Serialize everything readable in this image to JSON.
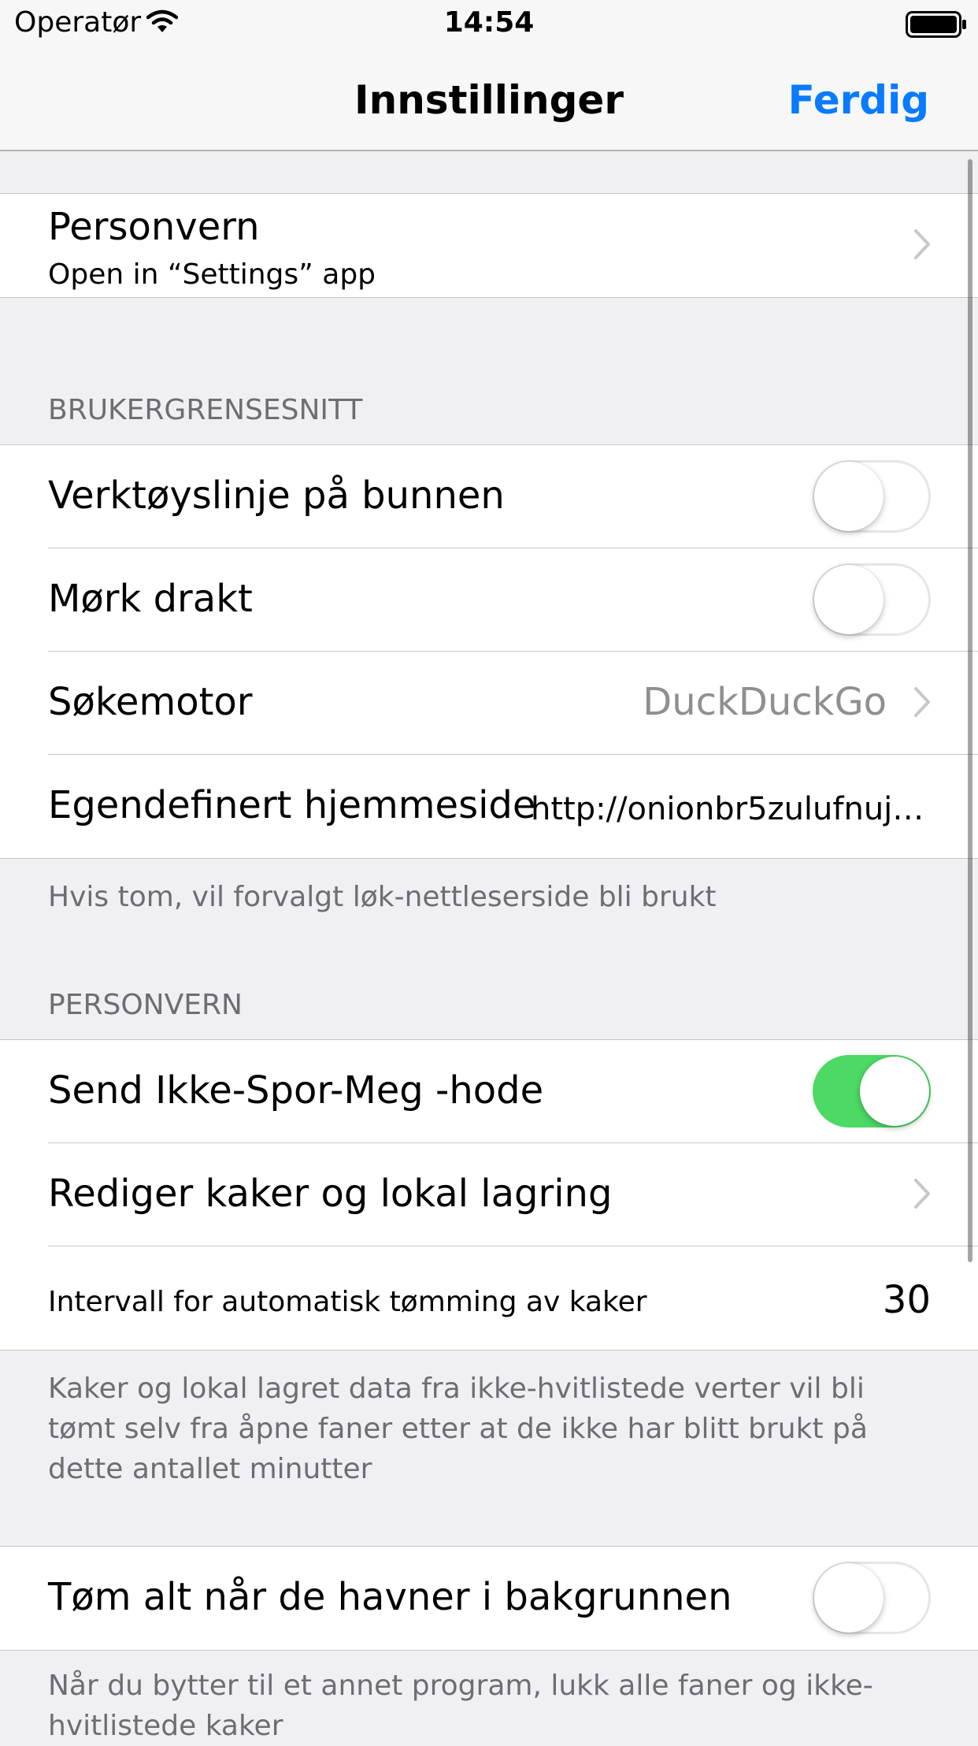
{
  "status_bar": {
    "carrier": "Operatør",
    "time": "14:54"
  },
  "nav_bar": {
    "title": "Innstillinger",
    "done_label": "Ferdig"
  },
  "privacy_link": {
    "title": "Personvern",
    "subtitle": "Open in “Settings” app"
  },
  "ui_section": {
    "header": "BRUKERGRENSESNITT",
    "bottom_toolbar": {
      "label": "Verktøyslinje på bunnen",
      "enabled": false
    },
    "dark_theme": {
      "label": "Mørk drakt",
      "enabled": false
    },
    "search_engine": {
      "label": "Søkemotor",
      "value": "DuckDuckGo"
    },
    "homepage": {
      "label": "Egendefinert hjemmeside",
      "value": "http://onionbr5zulufnuj.o…"
    },
    "footer": "Hvis tom, vil forvalgt løk-nettleserside bli brukt"
  },
  "privacy_section": {
    "header": "PERSONVERN",
    "dnt": {
      "label": "Send Ikke-Spor-Meg -hode",
      "enabled": true
    },
    "cookies": {
      "label": "Rediger kaker og lokal lagring"
    },
    "interval": {
      "label": "Intervall for automatisk tømming av kaker",
      "value": "30"
    },
    "footer": "Kaker og lokal lagret data fra ikke-hvitlistede verter vil bli tømt selv fra åpne faner etter at de ikke har blitt brukt på dette antallet minutter"
  },
  "background_section": {
    "clear_all": {
      "label": "Tøm alt når de havner i bakgrunnen",
      "enabled": false
    },
    "footer": "Når du bytter til et annet program, lukk alle faner og ikke-hvitlistede kaker"
  },
  "colors": {
    "accent": "#0a7aff",
    "toggle_on": "#4cd964",
    "background": "#efeff4"
  }
}
